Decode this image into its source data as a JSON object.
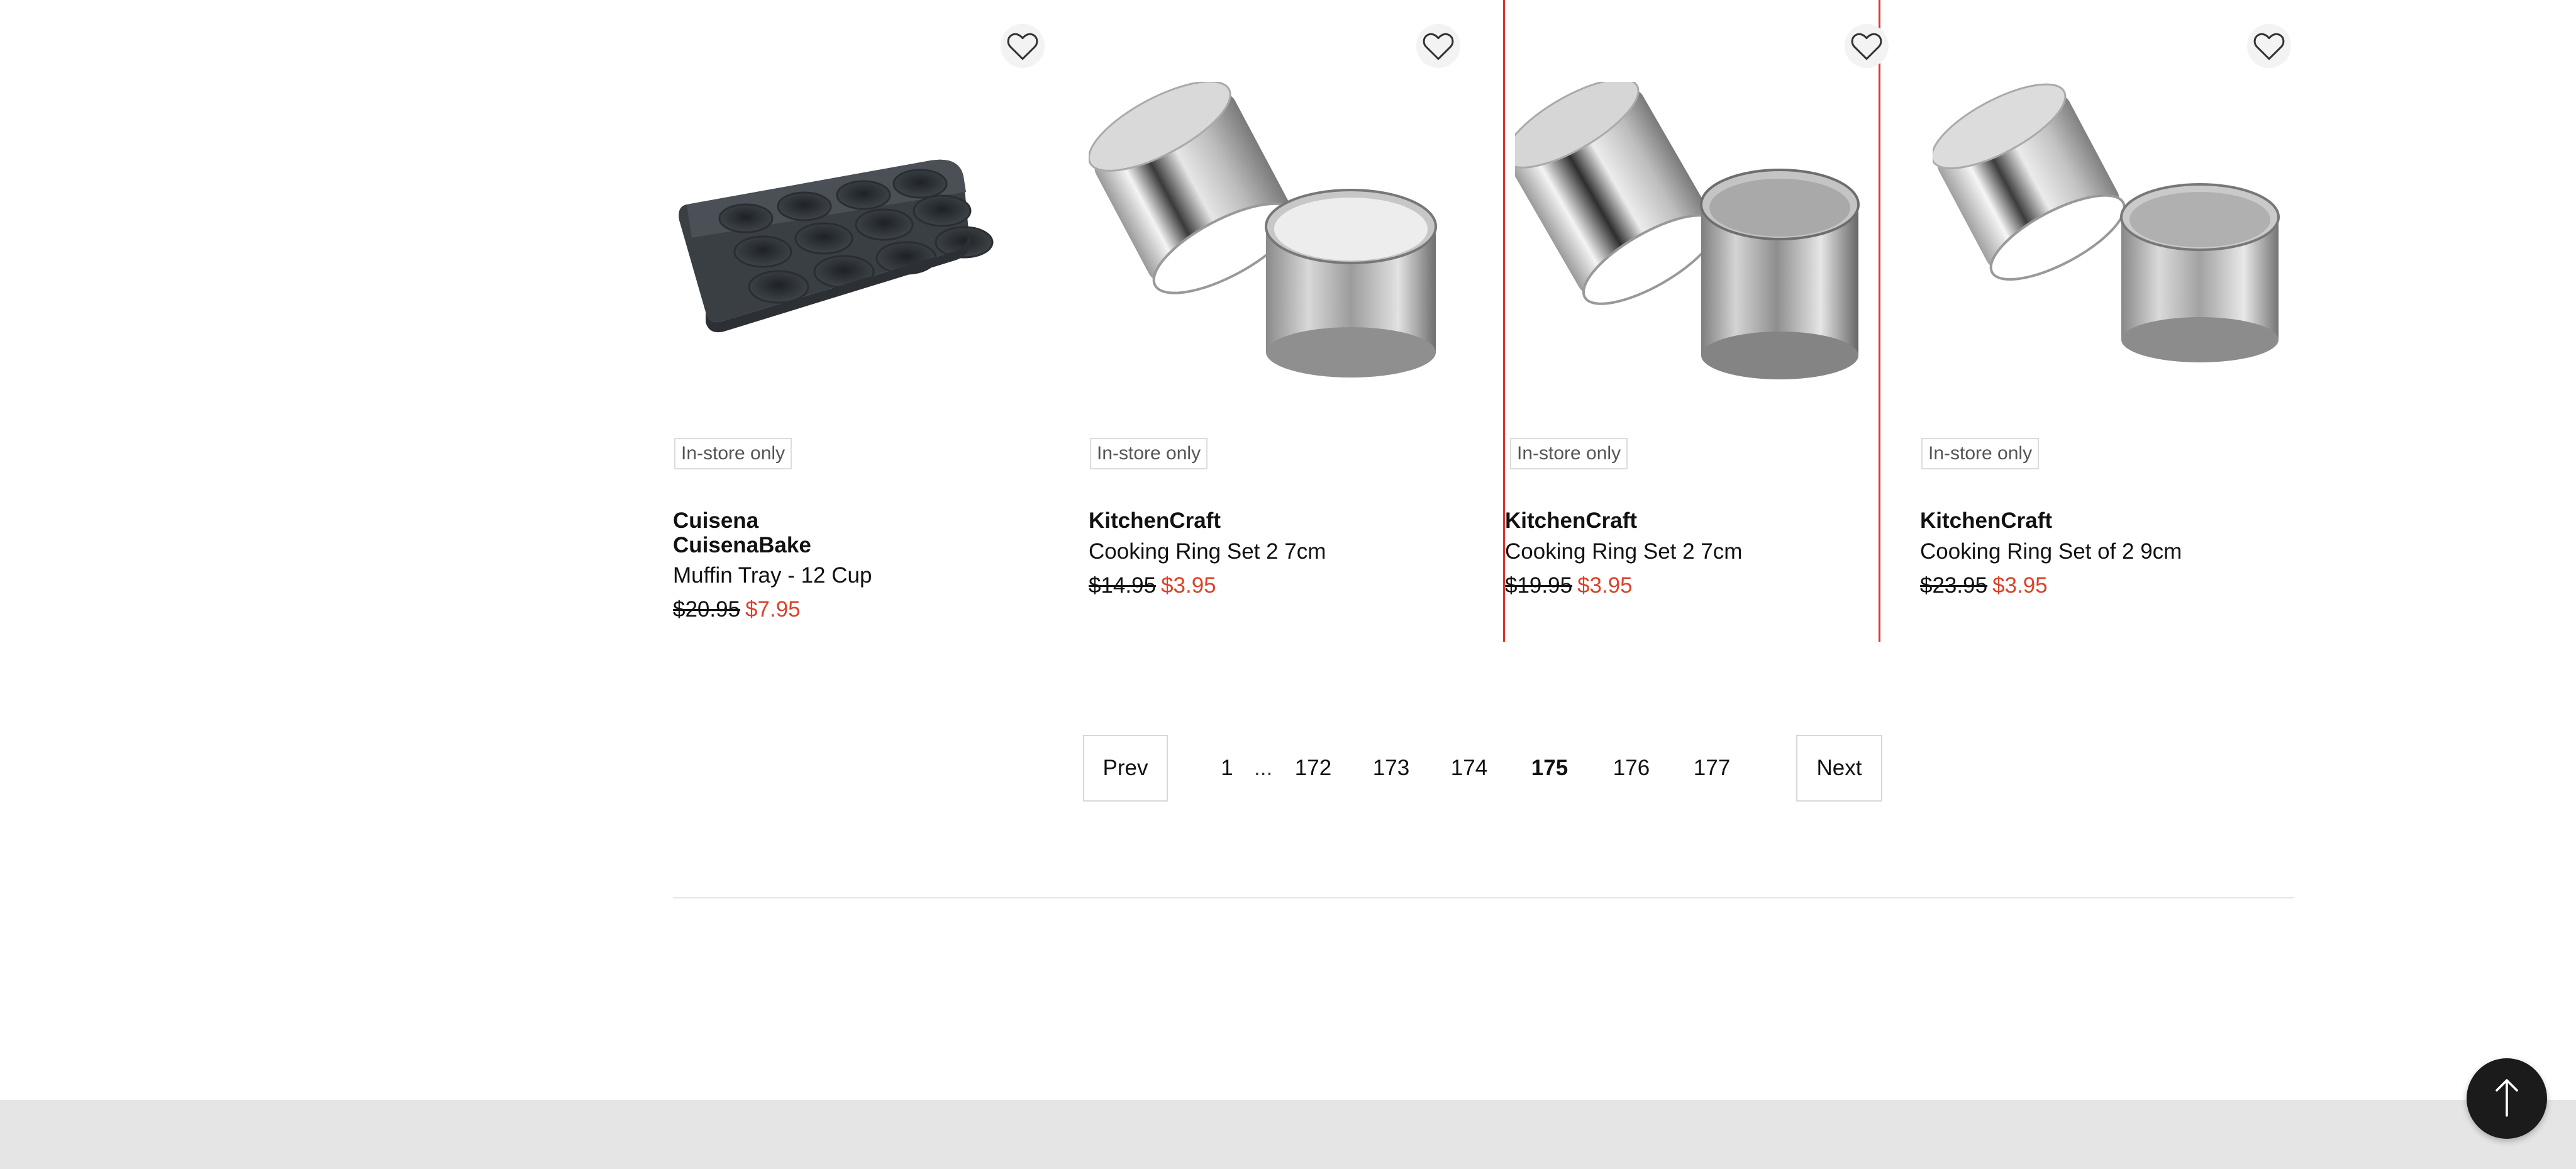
{
  "products": [
    {
      "badge": "In-store only",
      "brand": "Cuisena CuisenaBake",
      "name": "Muffin Tray - 12 Cup",
      "was_price": "$20.95",
      "now_price": "$7.95",
      "image_icon": "muffin-tray-icon"
    },
    {
      "badge": "In-store only",
      "brand": "KitchenCraft",
      "name": "Cooking Ring Set 2 7cm",
      "was_price": "$14.95",
      "now_price": "$3.95",
      "image_icon": "cooking-rings-icon"
    },
    {
      "badge": "In-store only",
      "brand": "KitchenCraft",
      "name": "Cooking Ring Set 2 7cm",
      "was_price": "$19.95",
      "now_price": "$3.95",
      "image_icon": "cooking-rings-icon"
    },
    {
      "badge": "In-store only",
      "brand": "KitchenCraft",
      "name": "Cooking Ring Set of 2 9cm",
      "was_price": "$23.95",
      "now_price": "$3.95",
      "image_icon": "cooking-rings-icon"
    }
  ],
  "pagination": {
    "prev_label": "Prev",
    "next_label": "Next",
    "first": "1",
    "ellipsis": "...",
    "pages": [
      "172",
      "173",
      "174",
      "175",
      "176",
      "177"
    ],
    "current": "175"
  },
  "colors": {
    "sale_price": "#d9432a",
    "selected_outline": "#e0312b",
    "back_to_top_bg": "#1b1b1b",
    "footer_band": "#e5e5e5"
  },
  "icons": {
    "favorite": "heart-outline-icon",
    "back_to_top": "arrow-up-icon"
  }
}
